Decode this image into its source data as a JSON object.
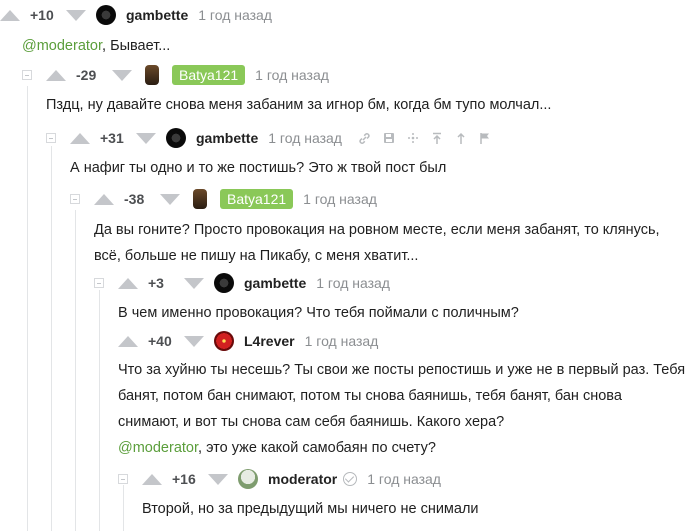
{
  "comments": [
    {
      "score": "+10",
      "nick": "gambette",
      "time": "1 год назад",
      "mention": "@moderator",
      "text": ", Бывает..."
    },
    {
      "score": "-29",
      "nick": "Batya121",
      "time": "1 год назад",
      "text": "Пздц, ну давайте снова меня забаним за игнор бм, когда бм тупо молчал..."
    },
    {
      "score": "+31",
      "nick": "gambette",
      "time": "1 год назад",
      "text": "А нафиг ты одно и то же постишь? Это ж твой пост был"
    },
    {
      "score": "-38",
      "nick": "Batya121",
      "time": "1 год назад",
      "text_line1": "Да вы гоните? Просто провокация на ровном месте, если меня забанят, то клянусь,",
      "text_line2": "всё, больше не пишу на Пикабу, с меня хватит..."
    },
    {
      "score": "+3",
      "nick": "gambette",
      "time": "1 год назад",
      "text": "В чем именно провокация? Что тебя поймали с поличным?"
    },
    {
      "score": "+40",
      "nick": "L4rever",
      "time": "1 год назад",
      "text_line1": "Что за хуйню ты несешь? Ты свои же посты репостишь и уже не в первый раз. Тебя",
      "text_line2": "банят, потом бан снимают, потом ты снова баянишь, тебя банят, бан снова",
      "text_line3": "снимают, и вот ты снова сам себя баянишь. Какого хера?",
      "mention": "@moderator",
      "text_line4": ", это уже какой самобаян по счету?"
    },
    {
      "score": "+16",
      "nick": "moderator",
      "time": "1 год назад",
      "text": "Второй, но за предыдущий мы ничего не снимали"
    }
  ],
  "tool_icons": [
    "link-icon",
    "save-icon",
    "share-icon",
    "pin-top-icon",
    "move-up-icon",
    "flag-icon"
  ]
}
